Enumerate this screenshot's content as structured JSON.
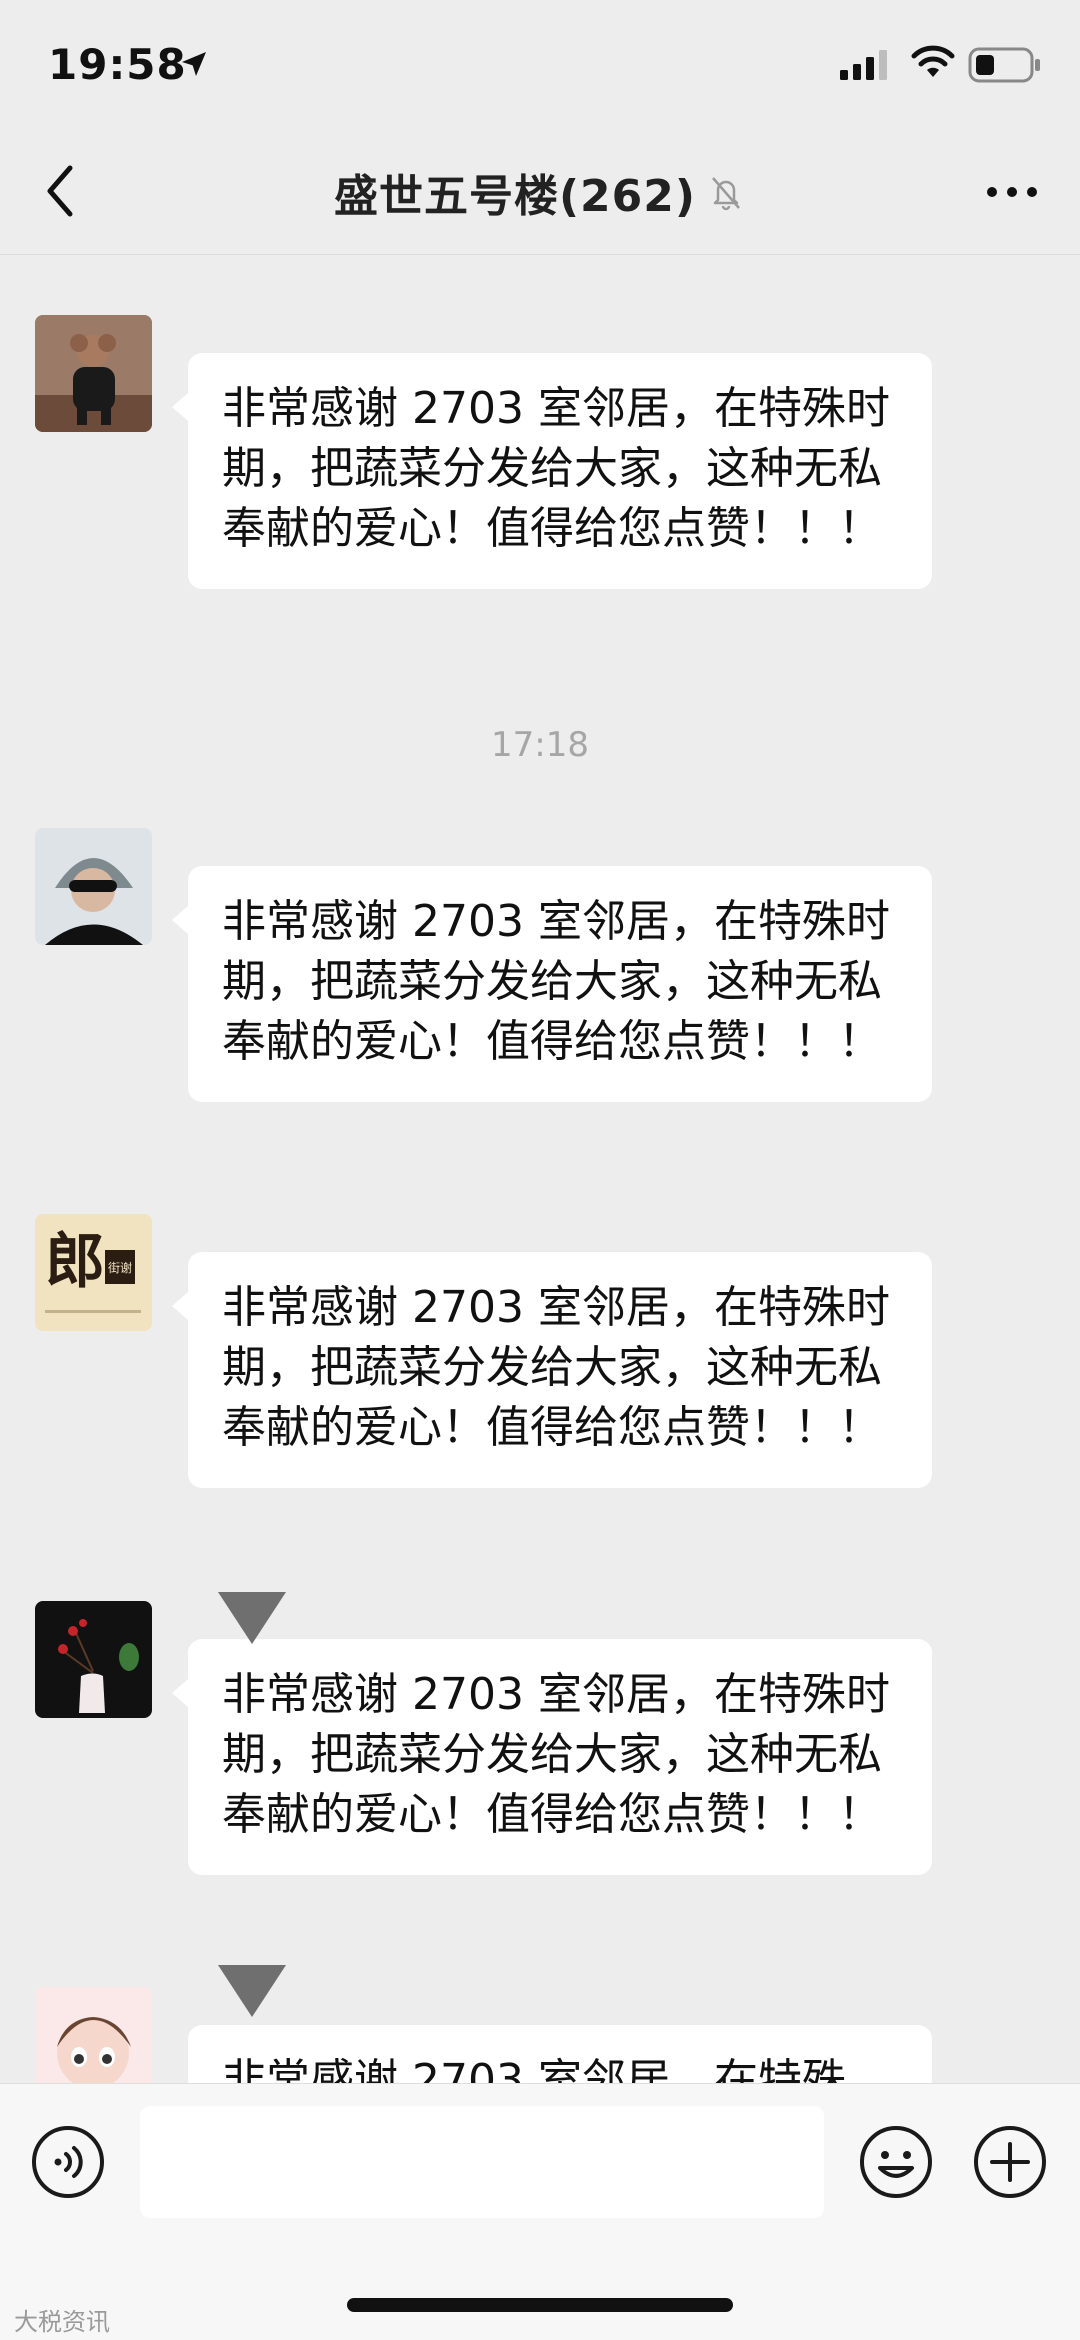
{
  "status_bar": {
    "time": "19:58"
  },
  "header": {
    "title": "盛世五号楼(262)",
    "back_icon": "chevron-left-icon",
    "mute_icon": "bell-off-icon",
    "more_icon": "more-dots-icon"
  },
  "messages": [
    {
      "text": "非常感谢 2703 室邻居，在特殊时期，把蔬菜分发给大家，这种无私奉献的爱心！值得给您点赞！！！"
    },
    {
      "text": "非常感谢 2703 室邻居，在特殊时期，把蔬菜分发给大家，这种无私奉献的爱心！值得给您点赞！！！"
    },
    {
      "text": "非常感谢 2703 室邻居，在特殊时期，把蔬菜分发给大家，这种无私奉献的爱心！值得给您点赞！！！"
    },
    {
      "text": "非常感谢 2703 室邻居，在特殊时期，把蔬菜分发给大家，这种无私奉献的爱心！值得给您点赞！！！"
    },
    {
      "text": "非常感谢 2703 室邻居，在特殊"
    }
  ],
  "timestamp": "17:18",
  "avatar_3_text": "郎",
  "avatar_3_small": "街谢",
  "input_bar": {
    "voice_icon": "voice-icon",
    "emoji_icon": "emoji-icon",
    "plus_icon": "plus-circle-icon"
  },
  "watermark": "大税资讯"
}
